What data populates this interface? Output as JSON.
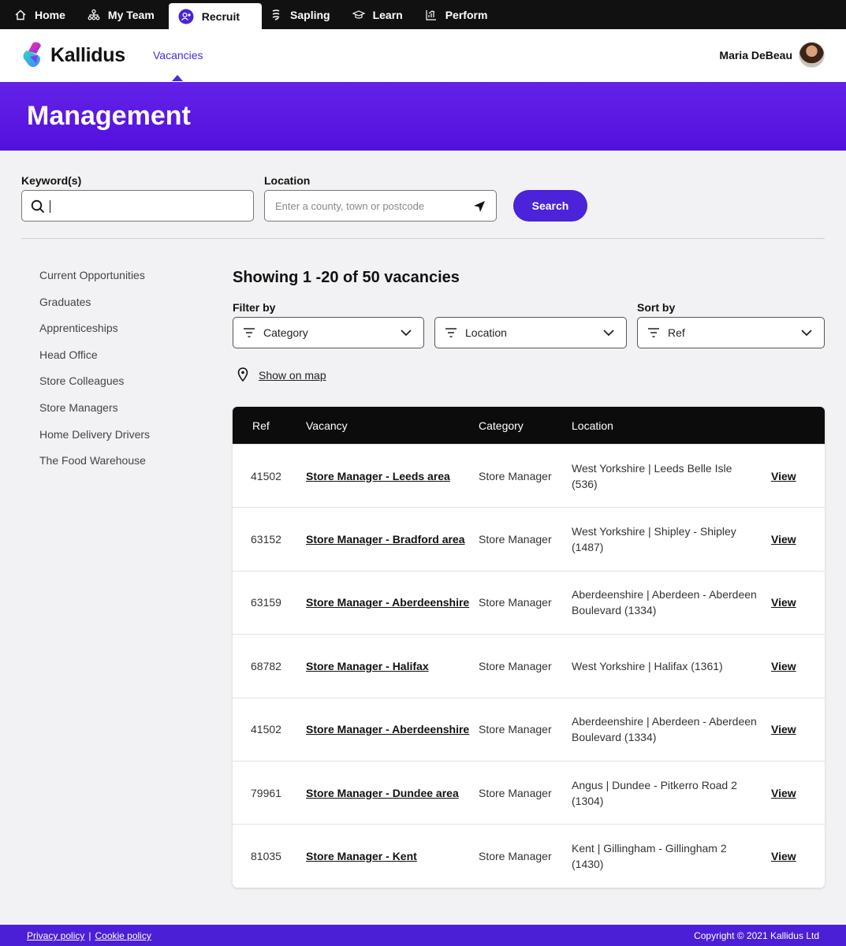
{
  "topnav": {
    "tabs": [
      {
        "label": "Home",
        "icon": "home-icon"
      },
      {
        "label": "My Team",
        "icon": "team-icon"
      },
      {
        "label": "Recruit",
        "icon": "recruit-icon",
        "active": true
      },
      {
        "label": "Sapling",
        "icon": "sapling-icon"
      },
      {
        "label": "Learn",
        "icon": "learn-icon"
      },
      {
        "label": "Perform",
        "icon": "perform-icon"
      }
    ]
  },
  "header": {
    "logo_text": "Kallidus",
    "nav_link": "Vacancies",
    "user_name": "Maria DeBeau"
  },
  "banner": {
    "title": "Management"
  },
  "search": {
    "keyword_label": "Keyword(s)",
    "keyword_value": "",
    "location_label": "Location",
    "location_placeholder": "Enter a county, town or postcode",
    "button_label": "Search"
  },
  "sidebar": {
    "items": [
      "Current Opportunities",
      "Graduates",
      "Apprenticeships",
      "Head Office",
      "Store Colleagues",
      "Store Managers",
      "Home Delivery Drivers",
      "The Food Warehouse"
    ]
  },
  "results": {
    "showing": "Showing 1 -20 of 50 vacancies",
    "filter_label": "Filter by",
    "sort_label": "Sort by",
    "filter_category": "Category",
    "filter_location": "Location",
    "sort_value": "Ref",
    "map_link": "Show on map"
  },
  "table": {
    "headers": {
      "ref": "Ref",
      "vacancy": "Vacancy",
      "category": "Category",
      "location": "Location"
    },
    "rows": [
      {
        "ref": "41502",
        "vacancy": "Store Manager - Leeds area",
        "category": "Store Manager",
        "location": "West Yorkshire | Leeds Belle Isle (536)",
        "action": "View"
      },
      {
        "ref": "63152",
        "vacancy": "Store Manager - Bradford area",
        "category": "Store Manager",
        "location": "West Yorkshire | Shipley - Shipley (1487)",
        "action": "View"
      },
      {
        "ref": "63159",
        "vacancy": "Store Manager - Aberdeenshire",
        "category": "Store Manager",
        "location": "Aberdeenshire | Aberdeen - Aberdeen Boulevard (1334)",
        "action": "View"
      },
      {
        "ref": "68782",
        "vacancy": "Store Manager - Halifax",
        "category": "Store Manager",
        "location": "West Yorkshire | Halifax (1361)",
        "action": "View"
      },
      {
        "ref": "41502",
        "vacancy": "Store Manager - Aberdeenshire",
        "category": "Store Manager",
        "location": "Aberdeenshire | Aberdeen - Aberdeen Boulevard (1334)",
        "action": "View"
      },
      {
        "ref": "79961",
        "vacancy": "Store Manager - Dundee area",
        "category": "Store Manager",
        "location": "Angus | Dundee - Pitkerro Road 2 (1304)",
        "action": "View"
      },
      {
        "ref": "81035",
        "vacancy": "Store Manager - Kent",
        "category": "Store Manager",
        "location": "Kent | Gillingham - Gillingham 2 (1430)",
        "action": "View"
      }
    ]
  },
  "footer": {
    "privacy": "Privacy policy",
    "separator": "|",
    "cookie": "Cookie policy",
    "copyright": "Copyright © 2021 Kallidus Ltd"
  },
  "colors": {
    "brand_purple": "#5310de",
    "button": "#4b23d8",
    "topnav_bg": "#111111"
  }
}
